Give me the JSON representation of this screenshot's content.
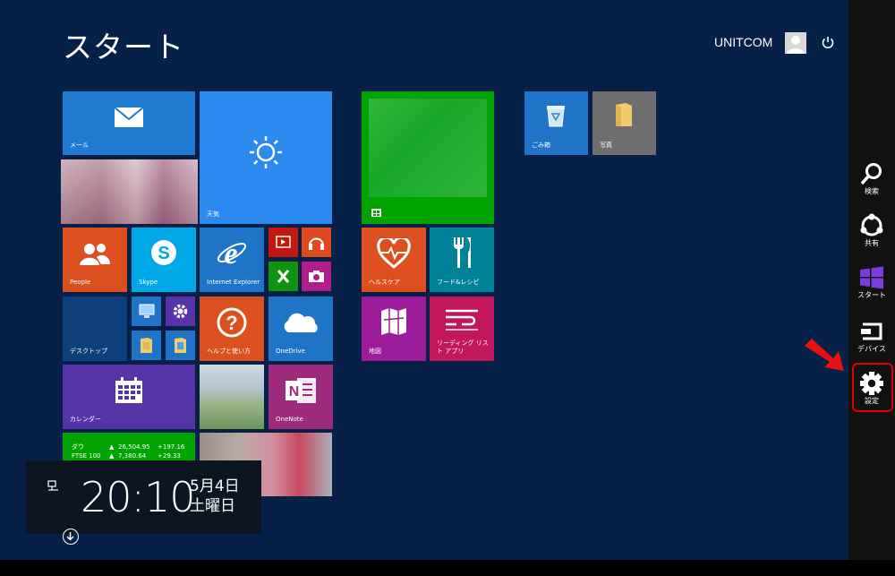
{
  "header": {
    "title": "スタート",
    "user_name": "UNITCOM"
  },
  "tiles": {
    "mail": "メール",
    "weather": "天気",
    "people": "People",
    "skype": "Skype",
    "ie": "Internet Explorer",
    "desktop": "デスクトップ",
    "help": "ヘルプと使い方",
    "onedrive": "OneDrive",
    "calendar": "カレンダー",
    "onenote": "OneNote",
    "health": "ヘルスケア",
    "food": "フード&レシピ",
    "maps": "地図",
    "reading": "リーディング リスト アプリ",
    "recycle": "ごみ箱",
    "photos": "写真"
  },
  "finance": {
    "rows": [
      {
        "name": "ダウ",
        "dir": "▲",
        "value": "26,504.95",
        "change": "+197.16"
      },
      {
        "name": "FTSE 100",
        "dir": "▲",
        "value": "7,380.64",
        "change": "+29.33"
      }
    ]
  },
  "clock": {
    "time": "20:10",
    "date": "5月4日",
    "day": "土曜日"
  },
  "charms": {
    "search": "検索",
    "share": "共有",
    "start": "スタート",
    "devices": "デバイス",
    "settings": "設定"
  },
  "colors": {
    "background": "#062047",
    "blue_tile": "#1f74c8",
    "orange_tile": "#dc4f1e",
    "purple_tile": "#5733a8",
    "green_tile": "#00a300",
    "teal_tile": "#008299",
    "magenta_tile": "#9c1d9b",
    "red_tile": "#c2185b",
    "charm_bar": "#111111",
    "highlight": "#e10000"
  }
}
